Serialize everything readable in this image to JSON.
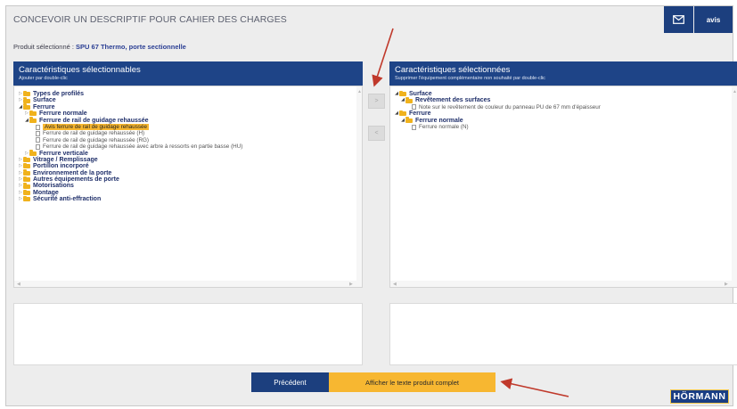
{
  "header": {
    "title": "CONCEVOIR UN DESCRIPTIF POUR CAHIER DES CHARGES",
    "mail_icon": "envelope-icon",
    "avis_label": "avis"
  },
  "product": {
    "label": "Produit sélectionné : ",
    "value": "SPU 67 Thermo, porte sectionnelle"
  },
  "left_panel": {
    "title": "Caractéristiques sélectionnables",
    "subtitle": "Ajouter par double-clic",
    "tree": [
      {
        "label": "Types de profilés",
        "type": "folder",
        "expanded": false
      },
      {
        "label": "Surface",
        "type": "folder",
        "expanded": false
      },
      {
        "label": "Ferrure",
        "type": "folder",
        "expanded": true
      },
      {
        "label": "Ferrure normale",
        "type": "folder",
        "expanded": false
      },
      {
        "label": "Ferrure de rail de guidage rehaussée",
        "type": "folder",
        "expanded": true
      },
      {
        "label": "Avis ferrure de rail de guidage rehaussée",
        "type": "doc",
        "selected": true
      },
      {
        "label": "Ferrure de rail de guidage rehaussée (H)",
        "type": "doc"
      },
      {
        "label": "Ferrure de rail de guidage rehaussée (RG)",
        "type": "doc"
      },
      {
        "label": "Ferrure de rail de guidage rehaussée avec arbre à ressorts en partie basse (HU)",
        "type": "doc"
      },
      {
        "label": "Ferrure verticale",
        "type": "folder",
        "expanded": false
      },
      {
        "label": "Vitrage / Remplissage",
        "type": "folder",
        "expanded": false
      },
      {
        "label": "Portillon incorporé",
        "type": "folder",
        "expanded": false
      },
      {
        "label": "Environnement de la porte",
        "type": "folder",
        "expanded": false
      },
      {
        "label": "Autres équipements de porte",
        "type": "folder",
        "expanded": false
      },
      {
        "label": "Motorisations",
        "type": "folder",
        "expanded": false
      },
      {
        "label": "Montage",
        "type": "folder",
        "expanded": false
      },
      {
        "label": "Sécurité anti-effraction",
        "type": "folder",
        "expanded": false
      }
    ]
  },
  "right_panel": {
    "title": "Caractéristiques sélectionnées",
    "subtitle": "Supprimer l'équipement complémentaire non souhaité par double-clic",
    "tree": [
      {
        "label": "Surface",
        "type": "folder",
        "expanded": true
      },
      {
        "label": "Revêtement des surfaces",
        "type": "folder",
        "expanded": true
      },
      {
        "label": "Note sur le revêtement de couleur du panneau PU de 67 mm d'épaisseur",
        "type": "doc"
      },
      {
        "label": "Ferrure",
        "type": "folder",
        "expanded": true
      },
      {
        "label": "Ferrure normale",
        "type": "folder",
        "expanded": true
      },
      {
        "label": "Ferrure normale (N)",
        "type": "doc"
      }
    ]
  },
  "mid_buttons": {
    "add": ">",
    "remove": "<"
  },
  "footer": {
    "prev_label": "Précédent",
    "full_text_label": "Afficher le texte produit complet",
    "logo": "HÖRMANN"
  },
  "colors": {
    "navy": "#1c3f7e",
    "accent": "#f7b731",
    "annotation": "#c0392b"
  }
}
